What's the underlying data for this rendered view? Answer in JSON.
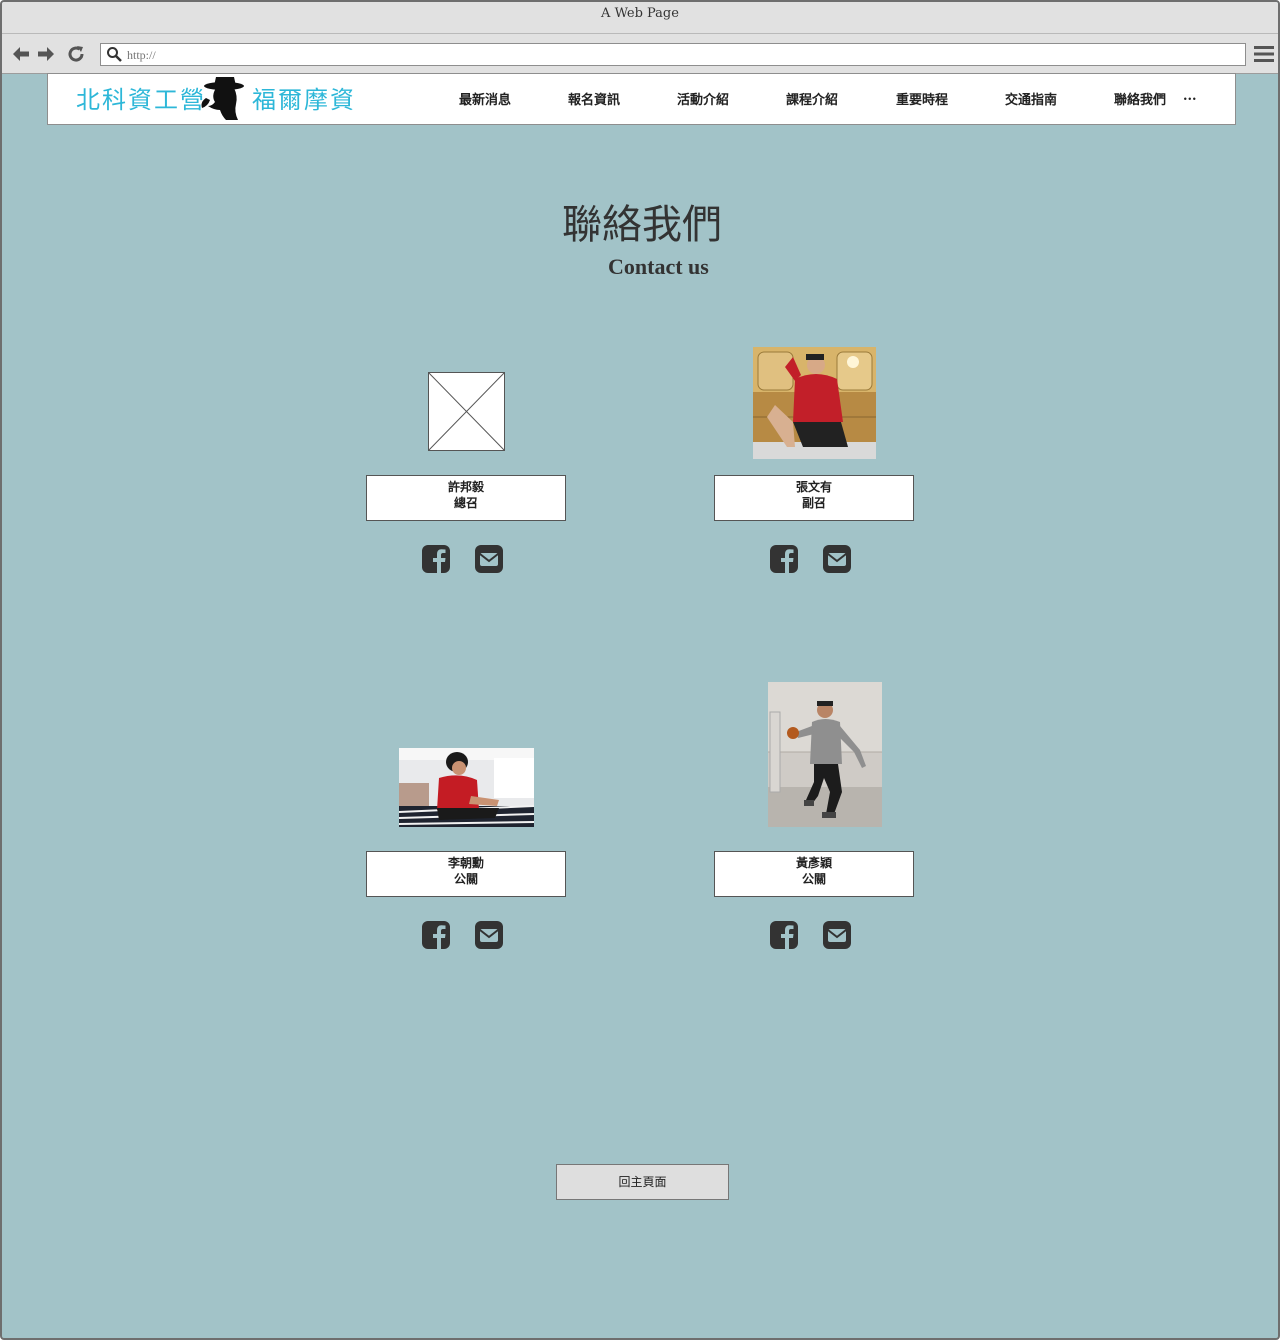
{
  "browser": {
    "window_title": "A Web Page",
    "url_placeholder": "http://"
  },
  "site": {
    "logo_text_left": "北科資工營",
    "logo_text_right": "福爾摩資",
    "logo_color": "#2db7d8",
    "nav": [
      "最新消息",
      "報名資訊",
      "活動介紹",
      "課程介紹",
      "重要時程",
      "交通指南",
      "聯絡我們",
      "..."
    ]
  },
  "page": {
    "title_zh": "聯絡我們",
    "title_en": "Contact us",
    "background": "#a2c3c8"
  },
  "contacts": [
    {
      "name": "許邦毅",
      "role": "總召",
      "photo": "placeholder"
    },
    {
      "name": "張文有",
      "role": "副召",
      "photo": "person-red-hoodie"
    },
    {
      "name": "李朝勳",
      "role": "公關",
      "photo": "person-red-shirt"
    },
    {
      "name": "黃彥穎",
      "role": "公關",
      "photo": "person-basketball"
    }
  ],
  "icons": {
    "social": "facebook-icon",
    "mail": "mail-icon"
  },
  "footer": {
    "home_button": "回主頁面"
  }
}
